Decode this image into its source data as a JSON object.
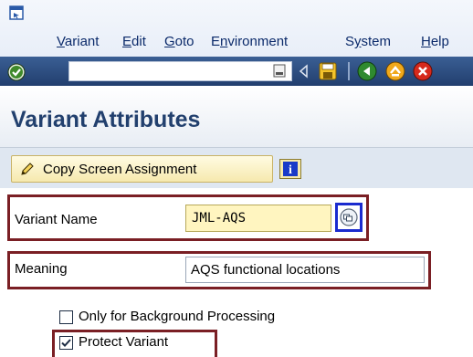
{
  "menu": {
    "items": [
      "Variant",
      "Edit",
      "Goto",
      "Environment",
      "System",
      "Help"
    ],
    "mnemonics": [
      "V",
      "E",
      "G",
      "n",
      "y",
      "H"
    ]
  },
  "toolbar": {
    "command_field_value": "",
    "icons": [
      "enter-icon",
      "dropdown-icon",
      "arrow-left-icon",
      "save-icon",
      "back-icon",
      "exit-icon",
      "cancel-icon"
    ]
  },
  "page": {
    "title": "Variant Attributes"
  },
  "app_toolbar": {
    "copy_button_label": "Copy Screen Assignment",
    "info_icon": "i"
  },
  "form": {
    "variant_name_label": "Variant Name",
    "variant_name_value": "JML-AQS",
    "meaning_label": "Meaning",
    "meaning_value": "AQS functional locations",
    "only_background_label": "Only for Background Processing",
    "only_background_checked": false,
    "protect_variant_label": "Protect Variant",
    "protect_variant_checked": true
  },
  "colors": {
    "highlight": "#7a1f24",
    "f4_focus": "#1a2bcf",
    "title": "#22406e",
    "toolbar": "#2f4f80"
  }
}
